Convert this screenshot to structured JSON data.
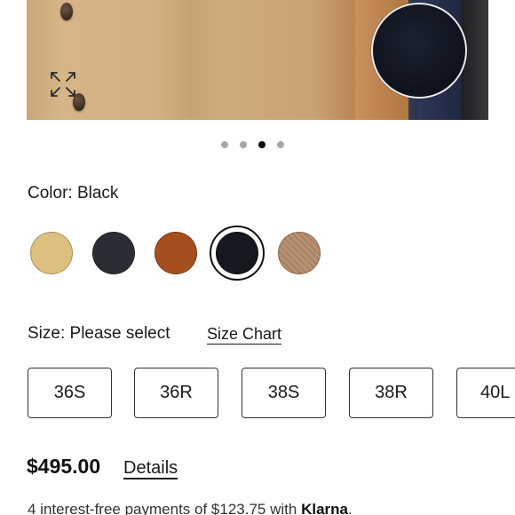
{
  "gallery": {
    "dots_count": 4,
    "active_index": 2
  },
  "color": {
    "label": "Color: Black",
    "swatches": [
      {
        "name": "camel",
        "hex": "#dcc07f"
      },
      {
        "name": "charcoal",
        "hex": "#2a2d33"
      },
      {
        "name": "cognac",
        "hex": "#a54f1f"
      },
      {
        "name": "black",
        "hex": "#15191f",
        "selected": true
      },
      {
        "name": "tan-herringbone",
        "hex": "#b89372"
      }
    ]
  },
  "size": {
    "label": "Size: Please select",
    "chart_link": "Size Chart",
    "options": [
      "36S",
      "36R",
      "38S",
      "38R",
      "40L"
    ]
  },
  "price": {
    "value": "$495.00",
    "details_link": "Details"
  },
  "klarna": {
    "text": "4 interest-free payments of $123.75 with ",
    "brand": "Klarna",
    "suffix": "."
  }
}
